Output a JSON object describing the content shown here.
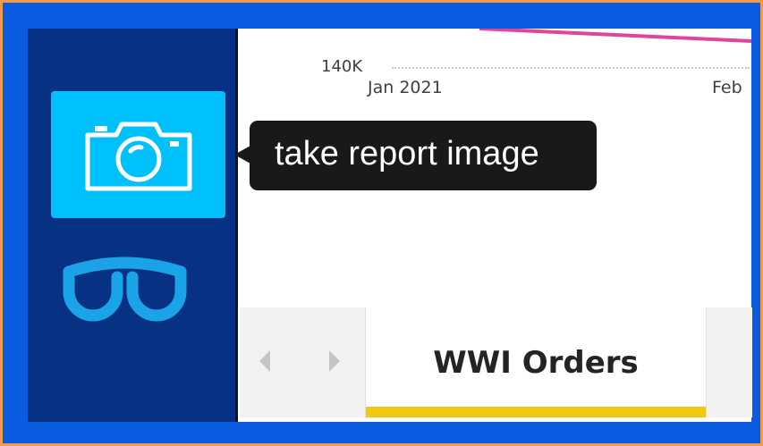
{
  "chart": {
    "y_tick": "140K",
    "x_tick_1": "Jan 2021",
    "x_tick_2": "Feb"
  },
  "tooltip": {
    "text": "take report image"
  },
  "tabs": {
    "active_label": "WWI Orders"
  },
  "colors": {
    "sidebar": "#073283",
    "camera_button": "#00c0fb",
    "tab_underline": "#f2c811",
    "line_series": "#e0449c"
  },
  "icons": {
    "camera": "camera-icon",
    "glasses": "glasses-icon",
    "prev": "chevron-left-icon",
    "next": "chevron-right-icon"
  }
}
